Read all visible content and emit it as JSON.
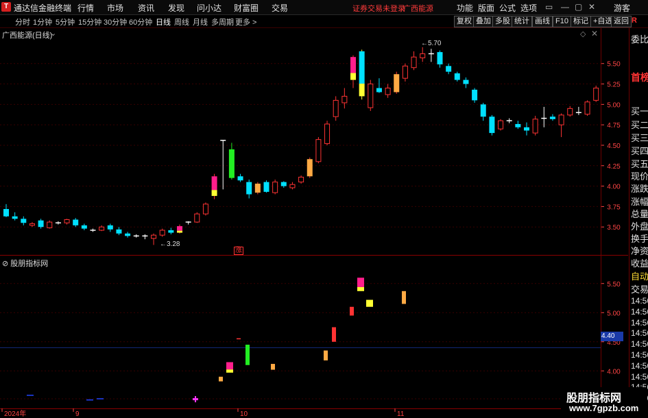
{
  "app": {
    "title": "通达信金融终端",
    "menu": [
      "行情",
      "市场",
      "资讯",
      "发现",
      "问小达",
      "财富圈",
      "交易"
    ],
    "login_status": "证券交易未登录",
    "stock_name": "广西能源",
    "right_menu": [
      "功能",
      "版面",
      "公式",
      "选项"
    ],
    "guest_label": "游客"
  },
  "toolbar": {
    "periods": [
      "分时",
      "1分钟",
      "5分钟",
      "15分钟",
      "30分钟",
      "60分钟",
      "日线",
      "周线",
      "月线",
      "多周期",
      "更多 >"
    ],
    "active_period": "日线",
    "buttons": [
      "复权",
      "叠加",
      "多股",
      "统计",
      "画线",
      "F10",
      "标记",
      "+自选",
      "返回"
    ]
  },
  "main_chart": {
    "title": "广西能源(日线)",
    "high_annotation": "5.70",
    "low_annotation": "3.28",
    "limit_up_marker": "涨"
  },
  "indicator_pane": {
    "title": "股朋指标网",
    "current_value_label": "4.40"
  },
  "right_panel": {
    "items": [
      "委比",
      "首榜",
      "买一",
      "买二",
      "买三",
      "买四",
      "买五",
      "现价",
      "涨跌",
      "涨幅",
      "总量",
      "外盘",
      "换手",
      "净资",
      "收益",
      "自动",
      "交易"
    ],
    "times": [
      "14:56",
      "14:56",
      "14:56",
      "14:56",
      "14:56",
      "14:56",
      "14:56",
      "14:56",
      "14:56",
      "14:56"
    ]
  },
  "watermark": {
    "line1": "股朋指标网",
    "line2": "www.7gpzb.com"
  },
  "colors": {
    "up": "#ff3333",
    "down": "#00e0ff",
    "limit": "#ff1e8c",
    "yellow": "#ffff33",
    "green": "#22ee22",
    "orange": "#ffaa44",
    "blue": "#2244ff",
    "magenta": "#ff33ff"
  },
  "chart_data": [
    {
      "type": "candlestick",
      "title": "广西能源(日线)",
      "x_labels": [
        "2024年",
        "9",
        "10",
        "11"
      ],
      "ylim": [
        3.2,
        5.85
      ],
      "y_ticks": [
        3.5,
        3.75,
        4.0,
        4.25,
        4.5,
        4.75,
        5.0,
        5.25,
        5.5
      ],
      "candles": [
        [
          3.72,
          3.78,
          3.62,
          3.63,
          "down"
        ],
        [
          3.63,
          3.68,
          3.58,
          3.6,
          "down"
        ],
        [
          3.6,
          3.63,
          3.52,
          3.55,
          "down"
        ],
        [
          3.52,
          3.56,
          3.5,
          3.54,
          "up"
        ],
        [
          3.58,
          3.6,
          3.48,
          3.5,
          "down"
        ],
        [
          3.49,
          3.58,
          3.48,
          3.56,
          "up"
        ],
        [
          3.55,
          3.57,
          3.53,
          3.55,
          "doji"
        ],
        [
          3.55,
          3.6,
          3.53,
          3.59,
          "up"
        ],
        [
          3.59,
          3.61,
          3.5,
          3.52,
          "down"
        ],
        [
          3.52,
          3.54,
          3.46,
          3.48,
          "down"
        ],
        [
          3.46,
          3.48,
          3.44,
          3.46,
          "doji"
        ],
        [
          3.46,
          3.52,
          3.45,
          3.5,
          "up"
        ],
        [
          3.52,
          3.54,
          3.44,
          3.47,
          "down"
        ],
        [
          3.47,
          3.5,
          3.4,
          3.42,
          "down"
        ],
        [
          3.42,
          3.44,
          3.37,
          3.39,
          "down"
        ],
        [
          3.39,
          3.41,
          3.37,
          3.39,
          "doji"
        ],
        [
          3.39,
          3.41,
          3.35,
          3.38,
          "doji"
        ],
        [
          3.36,
          3.42,
          3.28,
          3.4,
          "up"
        ],
        [
          3.4,
          3.48,
          3.38,
          3.46,
          "up"
        ],
        [
          3.46,
          3.49,
          3.41,
          3.43,
          "down"
        ],
        [
          3.43,
          3.53,
          3.42,
          3.51,
          "limit"
        ],
        [
          3.55,
          3.57,
          3.53,
          3.56,
          "doji"
        ],
        [
          3.56,
          3.68,
          3.55,
          3.66,
          "up"
        ],
        [
          3.66,
          3.8,
          3.64,
          3.78,
          "up"
        ],
        [
          3.88,
          4.15,
          3.84,
          4.12,
          "limit"
        ],
        [
          4.56,
          4.56,
          3.96,
          4.09,
          "doji"
        ],
        [
          4.45,
          4.53,
          4.08,
          4.1,
          "green"
        ],
        [
          4.12,
          4.15,
          4.05,
          4.07,
          "down"
        ],
        [
          4.05,
          4.08,
          3.85,
          3.9,
          "down"
        ],
        [
          3.92,
          4.05,
          3.9,
          4.03,
          "orange"
        ],
        [
          4.05,
          4.07,
          3.92,
          3.93,
          "down"
        ],
        [
          3.92,
          4.08,
          3.9,
          4.05,
          "up"
        ],
        [
          4.05,
          4.06,
          3.98,
          4.0,
          "down"
        ],
        [
          3.98,
          4.05,
          3.96,
          4.02,
          "up"
        ],
        [
          4.05,
          4.13,
          4.03,
          4.11,
          "up"
        ],
        [
          4.12,
          4.35,
          4.1,
          4.33,
          "orange"
        ],
        [
          4.3,
          4.6,
          4.28,
          4.57,
          "up"
        ],
        [
          4.52,
          4.8,
          4.5,
          4.76,
          "up"
        ],
        [
          4.85,
          5.1,
          4.8,
          5.05,
          "up"
        ],
        [
          5.1,
          5.2,
          4.95,
          5.02,
          "up"
        ],
        [
          5.3,
          5.6,
          5.2,
          5.58,
          "limit"
        ],
        [
          5.65,
          5.67,
          5.06,
          5.1,
          "yellow"
        ],
        [
          5.25,
          5.3,
          4.92,
          4.96,
          "up"
        ],
        [
          5.2,
          5.32,
          5.14,
          5.15,
          "down"
        ],
        [
          5.12,
          5.25,
          5.08,
          5.2,
          "up"
        ],
        [
          5.15,
          5.4,
          5.13,
          5.37,
          "orange"
        ],
        [
          5.32,
          5.5,
          5.28,
          5.47,
          "up"
        ],
        [
          5.45,
          5.65,
          5.42,
          5.58,
          "up"
        ],
        [
          5.57,
          5.7,
          5.52,
          5.62,
          "up"
        ],
        [
          5.62,
          5.68,
          5.52,
          5.6,
          "doji"
        ],
        [
          5.64,
          5.66,
          5.45,
          5.49,
          "down"
        ],
        [
          5.47,
          5.5,
          5.37,
          5.4,
          "down"
        ],
        [
          5.38,
          5.4,
          5.28,
          5.3,
          "down"
        ],
        [
          5.3,
          5.33,
          5.2,
          5.25,
          "down"
        ],
        [
          5.18,
          5.2,
          5.02,
          5.05,
          "down"
        ],
        [
          5.0,
          5.02,
          4.8,
          4.85,
          "down"
        ],
        [
          4.85,
          4.87,
          4.62,
          4.65,
          "down"
        ],
        [
          4.7,
          4.82,
          4.68,
          4.8,
          "up"
        ],
        [
          4.8,
          4.83,
          4.77,
          4.8,
          "doji"
        ],
        [
          4.76,
          4.8,
          4.7,
          4.72,
          "down"
        ],
        [
          4.72,
          4.78,
          4.62,
          4.68,
          "down"
        ],
        [
          4.65,
          4.86,
          4.62,
          4.82,
          "up"
        ],
        [
          4.8,
          4.97,
          4.72,
          4.83,
          "doji"
        ],
        [
          4.85,
          4.88,
          4.8,
          4.82,
          "down"
        ],
        [
          4.75,
          4.89,
          4.6,
          4.87,
          "up"
        ],
        [
          4.87,
          4.98,
          4.85,
          4.95,
          "up"
        ],
        [
          4.9,
          4.97,
          4.87,
          4.9,
          "doji"
        ],
        [
          4.88,
          5.05,
          4.86,
          5.03,
          "up"
        ],
        [
          5.05,
          5.23,
          5.03,
          5.2,
          "up"
        ],
        [
          5.22,
          5.3,
          5.1,
          5.13,
          "down"
        ]
      ]
    },
    {
      "type": "indicator_bars",
      "title": "股朋指标网",
      "ylim": [
        3.45,
        5.85
      ],
      "y_ticks": [
        4.0,
        4.5,
        5.0,
        5.5
      ],
      "bars": [
        [
          3.58,
          3.59,
          "blue"
        ],
        [
          3.5,
          3.51,
          "blue"
        ],
        [
          3.52,
          3.53,
          "blue"
        ],
        [
          3.5,
          3.52,
          "magenta"
        ],
        [
          3.82,
          3.9,
          "orange"
        ],
        [
          3.97,
          4.15,
          "limit"
        ],
        [
          4.55,
          4.56,
          "up"
        ],
        [
          4.1,
          4.45,
          "green"
        ],
        [
          4.02,
          4.12,
          "orange"
        ],
        [
          4.18,
          4.35,
          "orange"
        ],
        [
          4.5,
          4.75,
          "up"
        ],
        [
          4.95,
          5.1,
          "up"
        ],
        [
          5.37,
          5.6,
          "limit"
        ],
        [
          5.1,
          5.22,
          "yellow"
        ],
        [
          5.15,
          5.37,
          "orange"
        ]
      ]
    }
  ]
}
